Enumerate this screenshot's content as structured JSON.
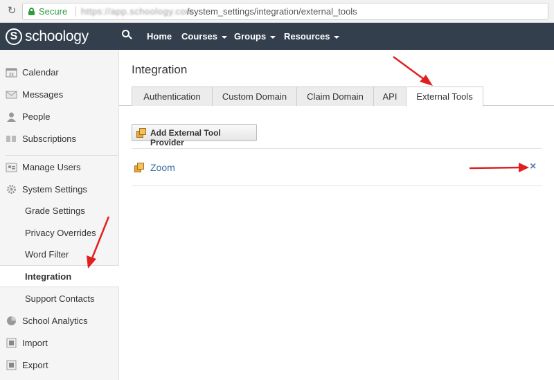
{
  "browser": {
    "secure_label": "Secure",
    "url_host": "https://app.schoology.com",
    "url_path": "/system_settings/integration/external_tools"
  },
  "nav": {
    "logo_text": "schoology",
    "items": [
      {
        "label": "Home"
      },
      {
        "label": "Courses"
      },
      {
        "label": "Groups"
      },
      {
        "label": "Resources"
      }
    ]
  },
  "sidebar": {
    "items": [
      {
        "label": "Calendar",
        "icon": "calendar-icon"
      },
      {
        "label": "Messages",
        "icon": "envelope-icon"
      },
      {
        "label": "People",
        "icon": "person-icon"
      },
      {
        "label": "Subscriptions",
        "icon": "quote-icon"
      },
      {
        "label": "Manage Users",
        "icon": "users-icon"
      },
      {
        "label": "System Settings",
        "icon": "gear-icon"
      },
      {
        "label": "Grade Settings"
      },
      {
        "label": "Privacy Overrides"
      },
      {
        "label": "Word Filter"
      },
      {
        "label": "Integration",
        "active": true
      },
      {
        "label": "Support Contacts"
      },
      {
        "label": "School Analytics",
        "icon": "analytics-icon"
      },
      {
        "label": "Import",
        "icon": "import-icon"
      },
      {
        "label": "Export",
        "icon": "export-icon"
      }
    ]
  },
  "main": {
    "title": "Integration",
    "tabs": [
      {
        "label": "Authentication"
      },
      {
        "label": "Custom Domain"
      },
      {
        "label": "Claim Domain"
      },
      {
        "label": "API"
      },
      {
        "label": "External Tools",
        "active": true
      }
    ],
    "add_button_label": "Add External Tool Provider",
    "tools": [
      {
        "name": "Zoom",
        "delete_symbol": "×"
      }
    ]
  },
  "colors": {
    "nav_bg": "#333f4d",
    "link": "#3b6ea5",
    "annotation_arrow": "#e02020",
    "secure_green": "#2e9b3d"
  }
}
